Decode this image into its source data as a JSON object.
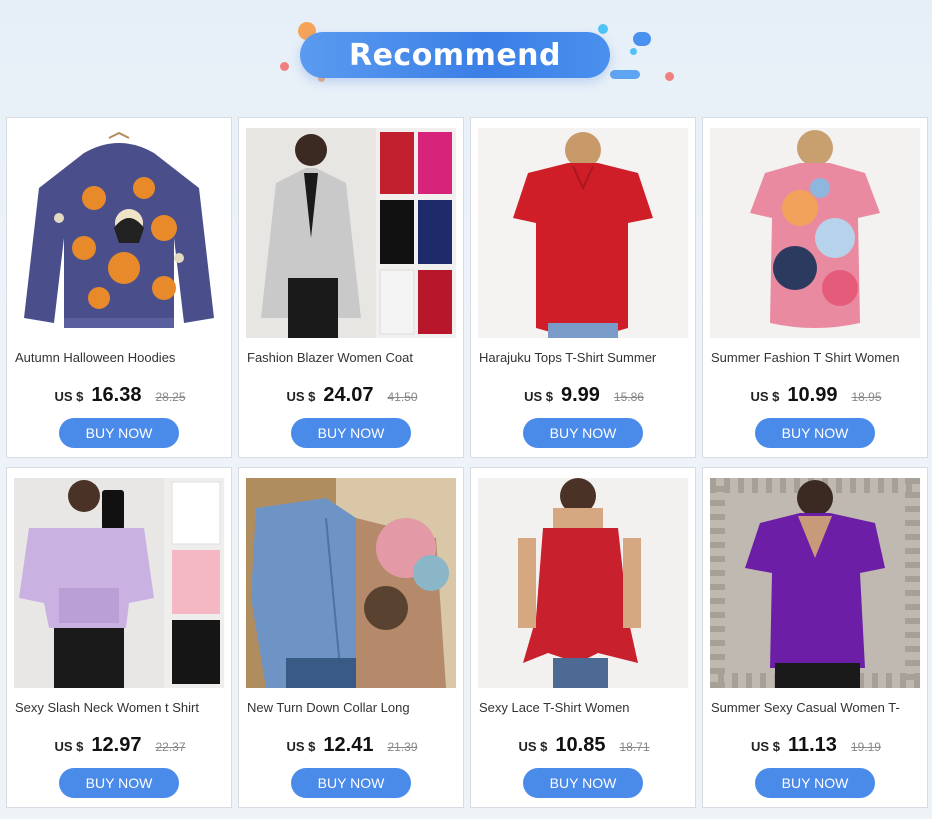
{
  "header": {
    "title": "Recommend"
  },
  "products": [
    {
      "name": "Autumn Halloween Hoodies",
      "currency": "US $",
      "price": "16.38",
      "old_price": "28.25",
      "button": "BUY NOW",
      "image": "halloween-hoodie-image"
    },
    {
      "name": "Fashion Blazer Women Coat",
      "currency": "US $",
      "price": "24.07",
      "old_price": "41.50",
      "button": "BUY NOW",
      "image": "blazer-coat-image"
    },
    {
      "name": "Harajuku Tops T-Shirt Summer",
      "currency": "US $",
      "price": "9.99",
      "old_price": "15.86",
      "button": "BUY NOW",
      "image": "red-tshirt-image"
    },
    {
      "name": "Summer Fashion T Shirt Women",
      "currency": "US $",
      "price": "10.99",
      "old_price": "18.95",
      "button": "BUY NOW",
      "image": "floral-tshirt-image"
    },
    {
      "name": "Sexy Slash Neck Women t Shirt",
      "currency": "US $",
      "price": "12.97",
      "old_price": "22.37",
      "button": "BUY NOW",
      "image": "offshoulder-shirt-image"
    },
    {
      "name": "New Turn Down Collar Long",
      "currency": "US $",
      "price": "12.41",
      "old_price": "21.39",
      "button": "BUY NOW",
      "image": "denim-shirt-image"
    },
    {
      "name": "Sexy Lace T-Shirt Women",
      "currency": "US $",
      "price": "10.85",
      "old_price": "18.71",
      "button": "BUY NOW",
      "image": "lace-tube-top-image"
    },
    {
      "name": "Summer Sexy Casual Women T-",
      "currency": "US $",
      "price": "11.13",
      "old_price": "19.19",
      "button": "BUY NOW",
      "image": "purple-wrap-top-image"
    }
  ],
  "colors": {
    "banner": "#3a7fe6",
    "button": "#4a8bea",
    "card_border": "#d9dde3"
  }
}
